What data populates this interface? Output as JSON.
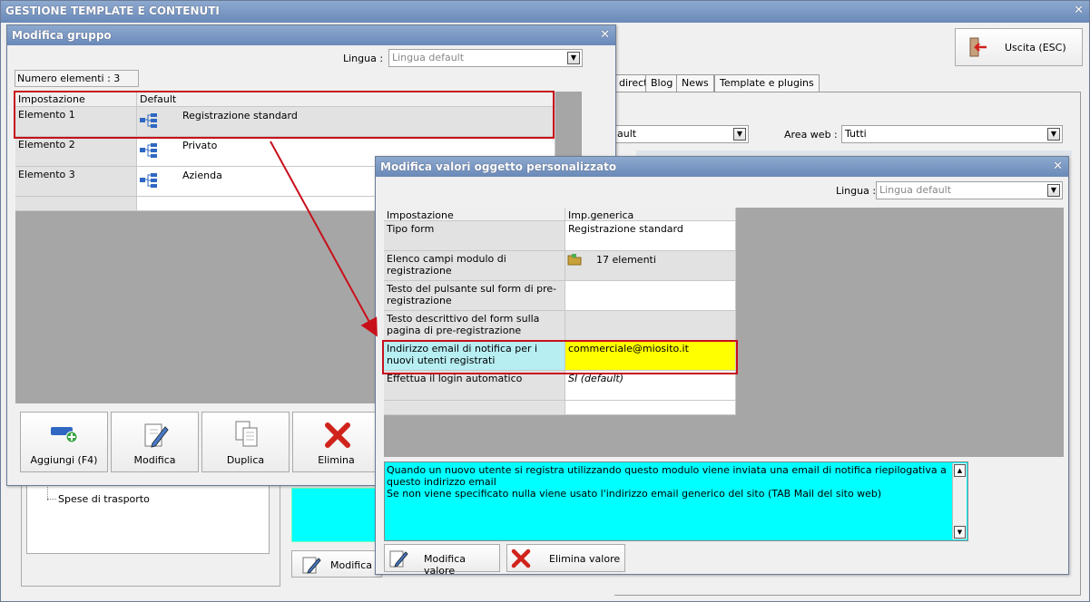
{
  "main_window": {
    "title": "GESTIONE TEMPLATE E CONTENUTI",
    "close_glyph": "✕",
    "exit_button": "Uscita (ESC)",
    "tabs": [
      "direct",
      "Blog",
      "News",
      "Template e plugins"
    ],
    "filter_combo_value": "ault",
    "area_web_label": "Area web :",
    "area_web_value": "Tutti",
    "tree_items": [
      "Spese di trasporto"
    ],
    "bottom_button": "Modifica"
  },
  "group_dialog": {
    "title": "Modifica gruppo",
    "close_glyph": "✕",
    "lingua_label": "Lingua :",
    "lingua_placeholder": "Lingua default",
    "count_label": "Numero elementi : 3",
    "columns": [
      "Impostazione",
      "Default"
    ],
    "rows": [
      {
        "name": "Elemento 1",
        "value": "Registrazione standard"
      },
      {
        "name": "Elemento 2",
        "value": "Privato"
      },
      {
        "name": "Elemento 3",
        "value": "Azienda"
      }
    ],
    "buttons": {
      "add": "Aggiungi (F4)",
      "edit": "Modifica",
      "duplicate": "Duplica",
      "delete": "Elimina"
    }
  },
  "values_dialog": {
    "title": "Modifica valori oggetto personalizzato",
    "close_glyph": "✕",
    "lingua_label": "Lingua :",
    "lingua_placeholder": "Lingua default",
    "columns": [
      "Impostazione",
      "Imp.generica"
    ],
    "rows": [
      {
        "name": "Tipo form",
        "value": "Registrazione standard"
      },
      {
        "name": "Elenco campi modulo di registrazione",
        "value": "17 elementi"
      },
      {
        "name": "Testo del pulsante sul form di pre-registrazione",
        "value": ""
      },
      {
        "name": "Testo descrittivo del form sulla pagina di pre-registrazione",
        "value": ""
      },
      {
        "name": "Indirizzo email di notifica per i nuovi utenti registrati",
        "value": "commerciale@miosito.it"
      },
      {
        "name": "Effettua il login automatico",
        "value": "SI (default)"
      }
    ],
    "help_text_line1": "Quando un nuovo utente si registra utilizzando questo modulo viene inviata una email di notifica riepilogativa a questo indirizzo email",
    "help_text_line2": "Se non viene specificato nulla viene usato l'indirizzo email generico del sito (TAB Mail del sito web)",
    "buttons": {
      "edit_value": "Modifica valore",
      "delete_value": "Elimina valore"
    }
  },
  "colors": {
    "title_bar": "#7a97c4",
    "highlight_cyan": "#b6eef2",
    "highlight_yellow": "#ffff00",
    "help_bg": "#00ffff",
    "annotation_red": "#c8101b"
  }
}
